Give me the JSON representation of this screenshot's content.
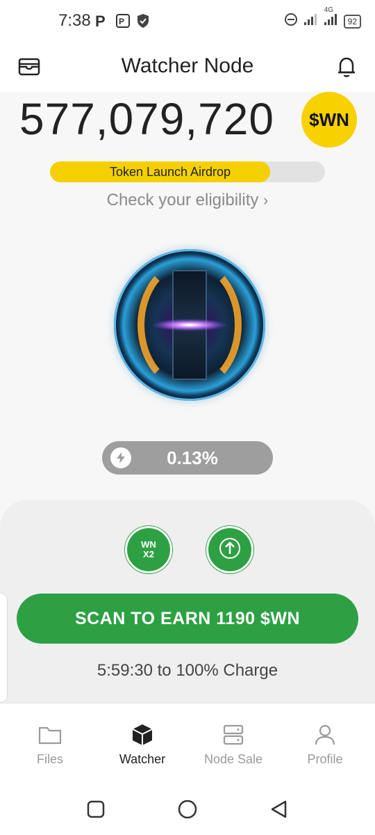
{
  "status_bar": {
    "time": "7:38",
    "network": "4G",
    "battery": "92"
  },
  "header": {
    "title": "Watcher Node"
  },
  "balance": {
    "amount": "577,079,720",
    "token_badge": "$WN"
  },
  "airdrop": {
    "label": "Token Launch Airdrop",
    "progress_fraction": 0.8,
    "eligibility_link": "Check your eligibility"
  },
  "charge": {
    "percent_label": "0.13%"
  },
  "boosts": {
    "multiplier_line1": "WN",
    "multiplier_line2": "X2"
  },
  "scan": {
    "button_label": "SCAN TO EARN 1190 $WN",
    "timer_text": "5:59:30 to 100% Charge"
  },
  "nav": {
    "items": [
      {
        "label": "Files",
        "icon": "folder-icon",
        "active": false
      },
      {
        "label": "Watcher",
        "icon": "cube-icon",
        "active": true
      },
      {
        "label": "Node Sale",
        "icon": "server-icon",
        "active": false
      },
      {
        "label": "Profile",
        "icon": "person-icon",
        "active": false
      }
    ]
  },
  "colors": {
    "accent_green": "#2ea044",
    "token_yellow": "#f7d100",
    "airdrop_fill": "#f4d000"
  }
}
